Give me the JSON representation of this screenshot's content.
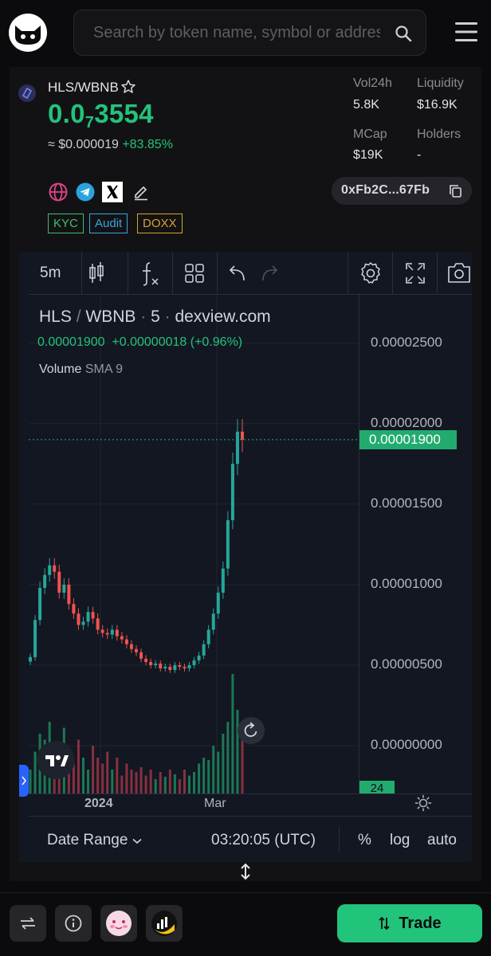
{
  "search": {
    "placeholder": "Search by token name, symbol or address"
  },
  "token": {
    "pair": "HLS/WBNB",
    "price_prefix": "0.0",
    "price_zeros": "7",
    "price_suffix": "3554",
    "usd_price": "≈ $0.000019",
    "change": "+83.85%",
    "address_short": "0xFb2C...67Fb"
  },
  "stats": {
    "vol24h_label": "Vol24h",
    "vol24h_value": "5.8K",
    "liquidity_label": "Liquidity",
    "liquidity_value": "$16.9K",
    "mcap_label": "MCap",
    "mcap_value": "$19K",
    "holders_label": "Holders",
    "holders_value": "-"
  },
  "badges": {
    "kyc": "KYC",
    "audit": "Audit",
    "doxx": "DOXX"
  },
  "toolbar": {
    "interval": "5m"
  },
  "chart_legend": {
    "symbol": "HLS",
    "quote": "WBNB",
    "interval": "5",
    "source": "dexview.com",
    "last": "0.00001900",
    "change_abs": "+0.00000018",
    "change_pct": "(+0.96%)",
    "volume": "Volume",
    "sma": "SMA 9"
  },
  "chart_data": {
    "type": "line",
    "ylim": [
      0,
      2.8e-05
    ],
    "y_ticks": [
      "0.00002500",
      "0.00002000",
      "0.00001500",
      "0.00001000",
      "0.00000500",
      "0.00000000"
    ],
    "y_tick_values": [
      2.5e-05,
      2e-05,
      1.5e-05,
      1e-05,
      5e-06,
      0
    ],
    "x_ticks": [
      "2024",
      "Mar"
    ],
    "last_price_label": "0.00001900",
    "last_price": 1.9e-05,
    "volume_tag": "24",
    "series": [
      {
        "values": [
          5.5e-06,
          7.8e-06,
          9.8e-06,
          1.06e-05,
          1.12e-05,
          1.08e-05,
          9.5e-06,
          1e-05,
          8.8e-06,
          8.2e-06,
          7.5e-06,
          7.7e-06,
          8.3e-06,
          7.9e-06,
          7.2e-06,
          7e-06,
          6.9e-06,
          7.2e-06,
          6.8e-06,
          6.6e-06,
          6.3e-06,
          6e-06,
          5.8e-06,
          5.4e-06,
          5.2e-06,
          5e-06,
          5.1e-06,
          4.8e-06,
          4.9e-06,
          4.7e-06,
          5e-06,
          4.9e-06,
          4.8e-06,
          5e-06,
          5.3e-06,
          5.6e-06,
          6.3e-06,
          7.2e-06,
          8.2e-06,
          9.5e-06,
          1.1e-05,
          1.4e-05,
          1.75e-05,
          1.95e-05,
          1.9e-05
        ]
      }
    ],
    "volume": [
      0.2,
      0.35,
      0.5,
      0.45,
      0.6,
      0.4,
      0.3,
      0.55,
      0.35,
      0.25,
      0.45,
      0.3,
      0.2,
      0.4,
      0.3,
      0.25,
      0.35,
      0.2,
      0.3,
      0.15,
      0.25,
      0.2,
      0.18,
      0.22,
      0.15,
      0.2,
      0.12,
      0.18,
      0.14,
      0.2,
      0.16,
      0.12,
      0.2,
      0.15,
      0.18,
      0.25,
      0.3,
      0.28,
      0.4,
      0.35,
      0.5,
      0.6,
      1.0,
      0.7,
      0.45
    ]
  },
  "time_axis": {
    "label_1": "2024",
    "label_2": "Mar"
  },
  "chart_footer": {
    "date_range": "Date Range",
    "time": "03:20:05 (UTC)",
    "pct": "%",
    "log": "log",
    "auto": "auto"
  },
  "trade": {
    "label": "Trade"
  },
  "colors": {
    "accent": "#22c37a",
    "kyc": "#3fbf6b",
    "audit": "#3aa6d8",
    "doxx": "#d8a22c",
    "chart_bg": "#131722"
  }
}
